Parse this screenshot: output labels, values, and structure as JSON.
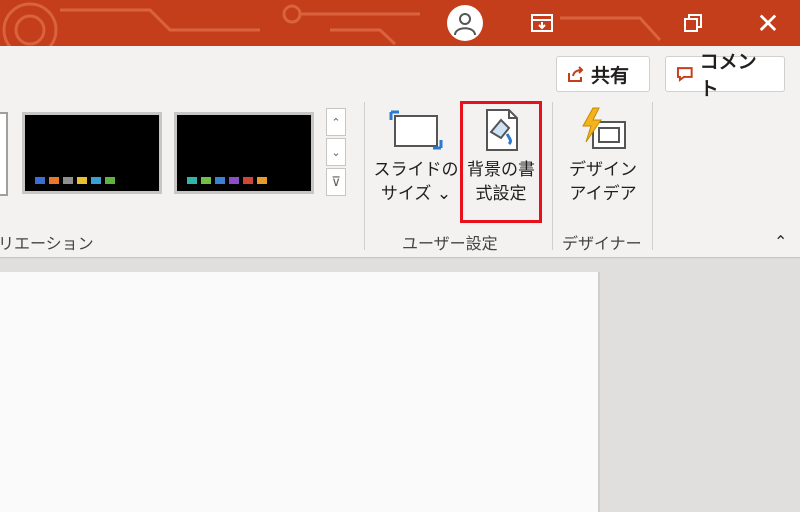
{
  "colors": {
    "titlebar": "#c43e1c",
    "highlight": "#e8101a",
    "ribbon": "#f3f2f1"
  },
  "icons": {
    "avatar": "person-icon",
    "ribbon_display": "ribbon-display-icon",
    "restore": "restore-icon",
    "close": "close-icon",
    "share": "share-icon",
    "comment": "comment-icon",
    "slide_size": "slide-size-icon",
    "format_background": "format-background-icon",
    "design_ideas": "design-ideas-icon"
  },
  "header": {
    "close_label": "✕"
  },
  "ribbon": {
    "share_label": "共有",
    "comment_label": "コメント",
    "variations_label": "リエーション",
    "user_settings_label": "ユーザー設定",
    "designer_label": "デザイナー",
    "slide_size": {
      "line1": "スライドの",
      "line2": "サイズ ⌄"
    },
    "format_background": {
      "line1": "背景の書",
      "line2": "式設定"
    },
    "design_ideas": {
      "line1": "デザイン",
      "line2": "アイデア"
    },
    "scroll_up": "⌃",
    "scroll_down": "⌄",
    "scroll_more": "⊽",
    "collapse": "⌃"
  },
  "variations": [
    {
      "swatches": [
        "#3a6fd1",
        "#e8782b",
        "#8f8f8f",
        "#e8c12b",
        "#3aa0d1",
        "#5fb33e"
      ]
    },
    {
      "swatches": [
        "#2fb6a6",
        "#6fbf4a",
        "#3a82d1",
        "#8a4fc8",
        "#d1463a",
        "#e89a2b"
      ]
    }
  ]
}
